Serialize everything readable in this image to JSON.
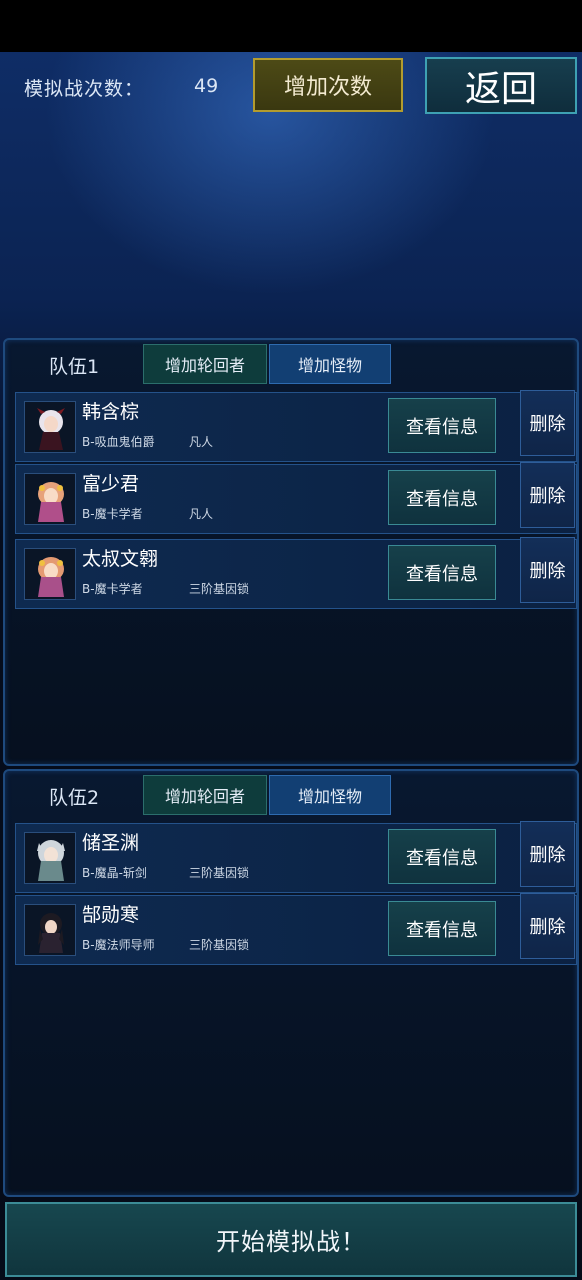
{
  "header": {
    "count_label": "模拟战次数：",
    "count_value": "49",
    "add_count_button": "增加次数",
    "back_button": "返回"
  },
  "teams": [
    {
      "label": "队伍1",
      "tab_reincarnator": "增加轮回者",
      "tab_monster": "增加怪物",
      "members": [
        {
          "name": "韩含棕",
          "class": "B-吸血鬼伯爵",
          "rank": "凡人",
          "info_button": "查看信息",
          "delete_button": "删除"
        },
        {
          "name": "富少君",
          "class": "B-魔卡学者",
          "rank": "凡人",
          "info_button": "查看信息",
          "delete_button": "删除"
        },
        {
          "name": "太叔文翱",
          "class": "B-魔卡学者",
          "rank": "三阶基因锁",
          "info_button": "查看信息",
          "delete_button": "删除"
        }
      ]
    },
    {
      "label": "队伍2",
      "tab_reincarnator": "增加轮回者",
      "tab_monster": "增加怪物",
      "members": [
        {
          "name": "储圣渊",
          "class": "B-魔晶-斩剑",
          "rank": "三阶基因锁",
          "info_button": "查看信息",
          "delete_button": "删除"
        },
        {
          "name": "郜勋寒",
          "class": "B-魔法师导师",
          "rank": "三阶基因锁",
          "info_button": "查看信息",
          "delete_button": "删除"
        }
      ]
    }
  ],
  "start_button": "开始模拟战！",
  "colors": {
    "background": "#050b18",
    "accent_gold": "#b39c2e",
    "accent_teal": "#3ea1b3",
    "panel_border": "#1e4a7e"
  },
  "icons": [
    "character-portrait-icon"
  ]
}
